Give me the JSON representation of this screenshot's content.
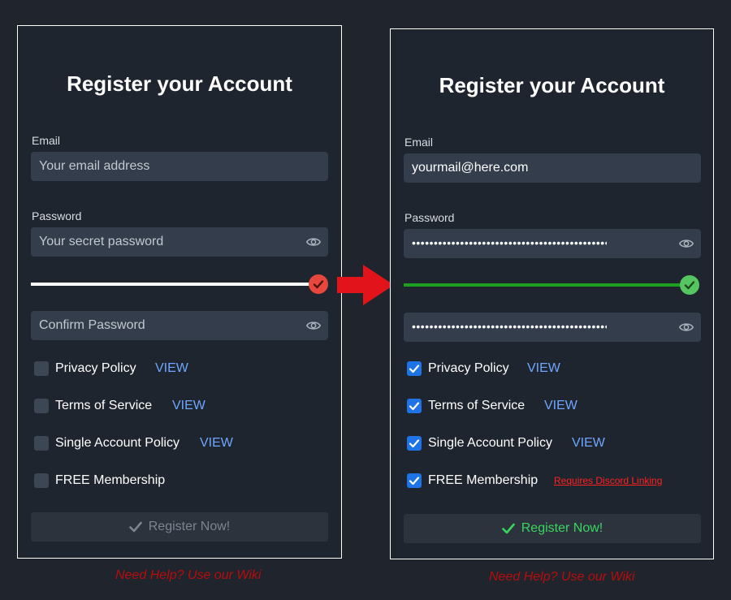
{
  "left": {
    "title": "Register your Account",
    "email_label": "Email",
    "email_placeholder": "Your email address",
    "password_label": "Password",
    "password_placeholder": "Your secret password",
    "confirm_placeholder": "Confirm Password",
    "strength_valid": false,
    "checkboxes": [
      {
        "label": "Privacy Policy",
        "link": "VIEW",
        "checked": false
      },
      {
        "label": "Terms of Service",
        "link": "VIEW",
        "checked": false
      },
      {
        "label": "Single Account Policy",
        "link": "VIEW",
        "checked": false
      },
      {
        "label": "FREE Membership",
        "link": "",
        "checked": false
      }
    ],
    "register_label": "Register Now!",
    "register_enabled": false
  },
  "right": {
    "title": "Register your Account",
    "email_label": "Email",
    "email_value": "yourmail@here.com",
    "password_label": "Password",
    "password_masked": "••••••••••••••••••••••••••••••••••••••••••••••••",
    "confirm_masked": "••••••••••••••••••••••••••••••••••••••••••••••••",
    "strength_valid": true,
    "checkboxes": [
      {
        "label": "Privacy Policy",
        "link": "VIEW",
        "checked": true
      },
      {
        "label": "Terms of Service",
        "link": "VIEW",
        "checked": true
      },
      {
        "label": "Single Account Policy",
        "link": "VIEW",
        "checked": true
      },
      {
        "label": "FREE Membership",
        "link": "Requires Discord Linking",
        "checked": true
      }
    ],
    "register_label": "Register Now!",
    "register_enabled": true
  },
  "help_text": "Need Help? Use our Wiki",
  "colors": {
    "invalid": "#e8473d",
    "valid": "#1da01d",
    "valid_dot": "#56c561",
    "arrow": "#e3131b",
    "checkbox_on": "#1e74e6",
    "link": "#6ea7ff"
  }
}
